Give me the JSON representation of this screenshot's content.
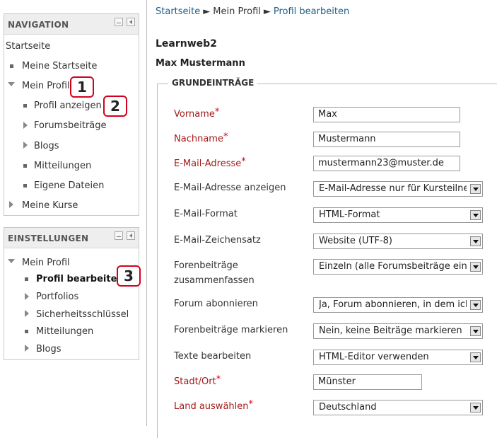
{
  "navigation": {
    "title": "NAVIGATION",
    "startseite": "Startseite",
    "meine_startseite": "Meine Startseite",
    "mein_profil": "Mein Profil",
    "profil_anzeigen": "Profil anzeigen",
    "forumsbeitraege": "Forumsbeiträge",
    "blogs": "Blogs",
    "mitteilungen": "Mitteilungen",
    "eigene_dateien": "Eigene Dateien",
    "meine_kurse": "Meine Kurse"
  },
  "einstellungen": {
    "title": "EINSTELLUNGEN",
    "mein_profil": "Mein Profil",
    "profil_bearbeiten": "Profil bearbeiten",
    "portfolios": "Portfolios",
    "sicherheitsschluessel": "Sicherheitsschlüssel",
    "mitteilungen": "Mitteilungen",
    "blogs": "Blogs"
  },
  "callouts": [
    "1",
    "2",
    "3"
  ],
  "breadcrumb": {
    "home": "Startseite",
    "profile": "Mein Profil",
    "current": "Profil bearbeiten",
    "separator": "►"
  },
  "page": {
    "site_title": "Learnweb2",
    "user_name": "Max Mustermann",
    "section_title": "GRUNDEINTRÄGE"
  },
  "form": {
    "vorname": {
      "label": "Vorname",
      "value": "Max"
    },
    "nachname": {
      "label": "Nachname",
      "value": "Mustermann"
    },
    "email": {
      "label": "E-Mail-Adresse",
      "value": "mustermann23@muster.de"
    },
    "email_anzeigen": {
      "label": "E-Mail-Adresse anzeigen",
      "value": "E-Mail-Adresse nur für Kursteilnehmer"
    },
    "email_format": {
      "label": "E-Mail-Format",
      "value": "HTML-Format"
    },
    "email_zeichensatz": {
      "label": "E-Mail-Zeichensatz",
      "value": "Website (UTF-8)"
    },
    "forenbeitraege_zusammenfassen": {
      "label_line1": "Forenbeiträge",
      "label_line2": "zusammenfassen",
      "value": "Einzeln (alle Forumsbeiträge einzeln)"
    },
    "forum_abonnieren": {
      "label": "Forum abonnieren",
      "value": "Ja, Forum abonnieren, in dem ich schreibe"
    },
    "forenbeitraege_markieren": {
      "label": "Forenbeiträge markieren",
      "value": "Nein, keine Beiträge markieren"
    },
    "texte_bearbeiten": {
      "label": "Texte bearbeiten",
      "value": "HTML-Editor verwenden"
    },
    "stadt": {
      "label": "Stadt/Ort",
      "value": "Münster"
    },
    "land": {
      "label": "Land auswählen",
      "value": "Deutschland"
    },
    "required_marker": "*"
  },
  "colors": {
    "required_label": "#a61818",
    "callout_border": "#d0021b",
    "link": "#1a5d8a",
    "block_header_bg": "#eeeeee"
  }
}
